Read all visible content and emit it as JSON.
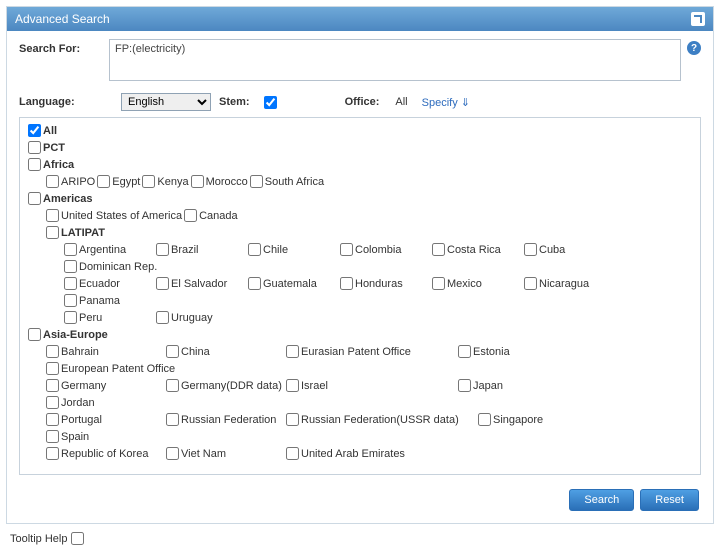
{
  "header": {
    "title": "Advanced Search"
  },
  "search": {
    "label": "Search For:",
    "value": "FP:(electricity)",
    "help_icon": "?"
  },
  "language": {
    "label": "Language:",
    "selected": "English"
  },
  "stem": {
    "label": "Stem:"
  },
  "office": {
    "label": "Office:",
    "value": "All",
    "specify": "Specify ⇓"
  },
  "groups": {
    "all": "All",
    "pct": "PCT",
    "africa": {
      "label": "Africa",
      "items": [
        "ARIPO",
        "Egypt",
        "Kenya",
        "Morocco",
        "South Africa"
      ]
    },
    "americas": {
      "label": "Americas",
      "top": [
        "United States of America",
        "Canada"
      ],
      "latipat": {
        "label": "LATIPAT",
        "rows": [
          [
            "Argentina",
            "Brazil",
            "Chile",
            "Colombia",
            "Costa Rica",
            "Cuba",
            "Dominican Rep."
          ],
          [
            "Ecuador",
            "El Salvador",
            "Guatemala",
            "Honduras",
            "Mexico",
            "Nicaragua",
            "Panama"
          ],
          [
            "Peru",
            "Uruguay"
          ]
        ]
      }
    },
    "asia_europe": {
      "label": "Asia-Europe",
      "rows": [
        [
          "Bahrain",
          "China",
          "Eurasian Patent Office",
          "Estonia",
          "European Patent Office"
        ],
        [
          "Germany",
          "Germany(DDR data)",
          "Israel",
          "Japan",
          "Jordan"
        ],
        [
          "Portugal",
          "Russian Federation",
          "Russian Federation(USSR data)",
          "Singapore",
          "Spain"
        ],
        [
          "Republic of Korea",
          "Viet Nam",
          "United Arab Emirates"
        ]
      ]
    }
  },
  "buttons": {
    "search": "Search",
    "reset": "Reset"
  },
  "tooltip": {
    "label": "Tooltip Help"
  }
}
